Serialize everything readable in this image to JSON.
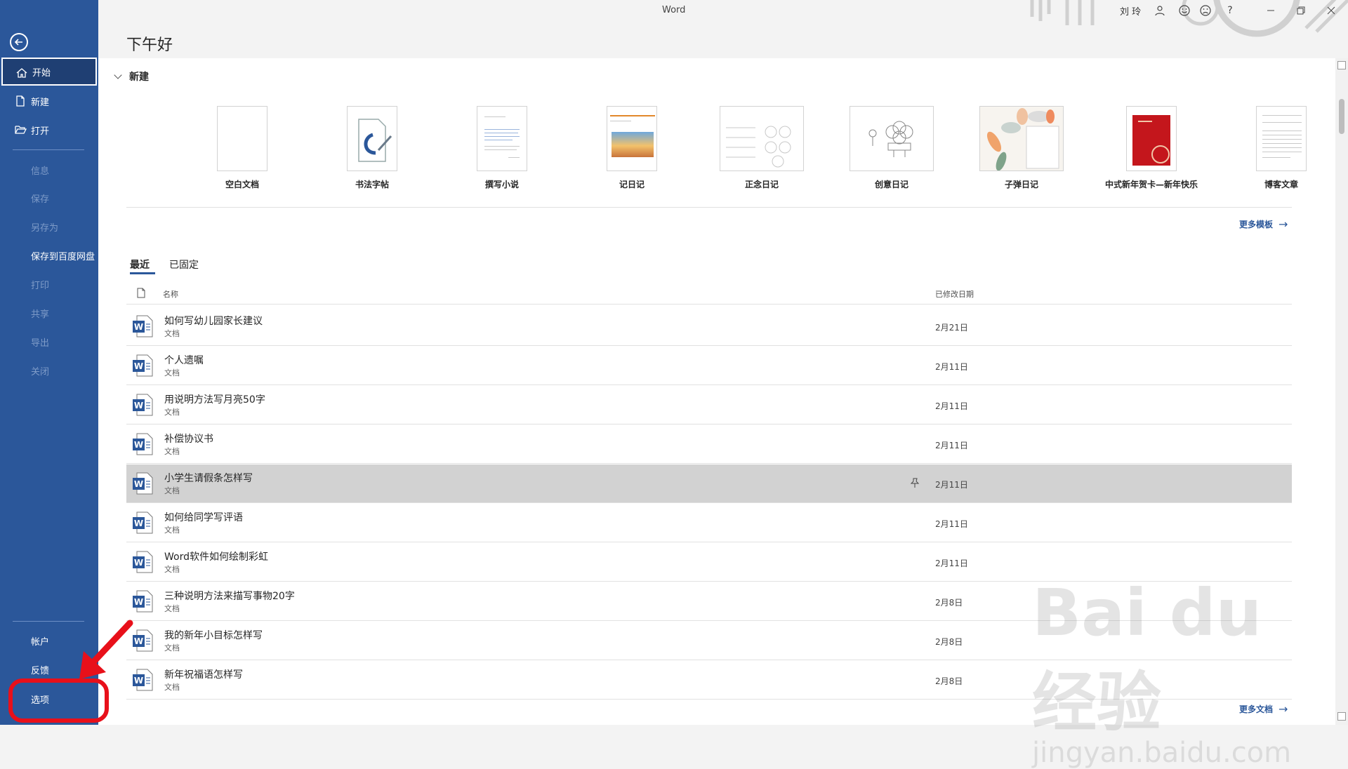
{
  "app": {
    "title": "Word",
    "user": "刘 玲"
  },
  "greeting": "下午好",
  "sidebar": {
    "items": [
      {
        "label": "开始",
        "state": "active"
      },
      {
        "label": "新建",
        "state": "normal"
      },
      {
        "label": "打开",
        "state": "normal"
      },
      {
        "label": "信息",
        "state": "disabled"
      },
      {
        "label": "保存",
        "state": "disabled"
      },
      {
        "label": "另存为",
        "state": "disabled"
      },
      {
        "label": "保存到百度网盘",
        "state": "normal"
      },
      {
        "label": "打印",
        "state": "disabled"
      },
      {
        "label": "共享",
        "state": "disabled"
      },
      {
        "label": "导出",
        "state": "disabled"
      },
      {
        "label": "关闭",
        "state": "disabled"
      }
    ],
    "bottom": [
      {
        "label": "帐户"
      },
      {
        "label": "反馈"
      },
      {
        "label": "选项"
      }
    ]
  },
  "new_section": {
    "title": "新建",
    "templates": [
      {
        "label": "空白文档"
      },
      {
        "label": "书法字帖"
      },
      {
        "label": "撰写小说"
      },
      {
        "label": "记日记"
      },
      {
        "label": "正念日记"
      },
      {
        "label": "创意日记"
      },
      {
        "label": "子弹日记"
      },
      {
        "label": "中式新年贺卡—新年快乐"
      },
      {
        "label": "博客文章"
      }
    ],
    "more_templates": "更多模板"
  },
  "tabs": [
    {
      "label": "最近"
    },
    {
      "label": "已固定"
    }
  ],
  "list": {
    "header_name": "名称",
    "header_date": "已修改日期",
    "rows": [
      {
        "name": "如何写幼儿园家长建议",
        "type": "文档",
        "date": "2月21日"
      },
      {
        "name": "个人遗嘱",
        "type": "文档",
        "date": "2月11日"
      },
      {
        "name": "用说明方法写月亮50字",
        "type": "文档",
        "date": "2月11日"
      },
      {
        "name": "补偿协议书",
        "type": "文档",
        "date": "2月11日"
      },
      {
        "name": "小学生请假条怎样写",
        "type": "文档",
        "date": "2月11日"
      },
      {
        "name": "如何给同学写评语",
        "type": "文档",
        "date": "2月11日"
      },
      {
        "name": "Word软件如何绘制彩虹",
        "type": "文档",
        "date": "2月11日"
      },
      {
        "name": "三种说明方法来描写事物20字",
        "type": "文档",
        "date": "2月8日"
      },
      {
        "name": "我的新年小目标怎样写",
        "type": "文档",
        "date": "2月8日"
      },
      {
        "name": "新年祝福语怎样写",
        "type": "文档",
        "date": "2月8日"
      }
    ],
    "more_docs": "更多文档"
  },
  "watermark": {
    "main": "Bai du 经验",
    "sub": "jingyan.baidu.com"
  },
  "colors": {
    "accent": "#2b579a",
    "annotation": "#e8101a"
  }
}
